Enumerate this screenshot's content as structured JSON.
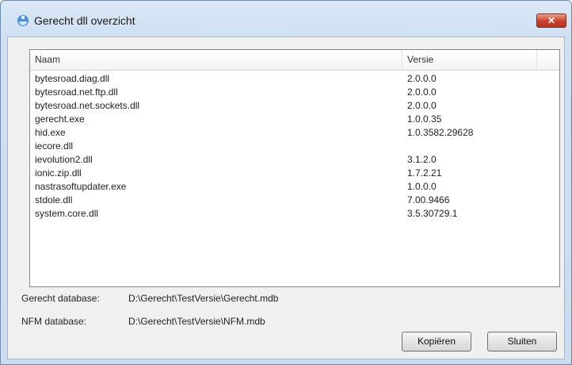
{
  "window": {
    "title": "Gerecht dll overzicht",
    "close_label": "✕"
  },
  "list": {
    "columns": {
      "naam": "Naam",
      "versie": "Versie"
    },
    "rows": [
      {
        "naam": "bytesroad.diag.dll",
        "versie": "2.0.0.0"
      },
      {
        "naam": "bytesroad.net.ftp.dll",
        "versie": "2.0.0.0"
      },
      {
        "naam": "bytesroad.net.sockets.dll",
        "versie": "2.0.0.0"
      },
      {
        "naam": "gerecht.exe",
        "versie": "1.0.0.35"
      },
      {
        "naam": "hid.exe",
        "versie": "1.0.3582.29628"
      },
      {
        "naam": "iecore.dll",
        "versie": ""
      },
      {
        "naam": "ievolution2.dll",
        "versie": "3.1.2.0"
      },
      {
        "naam": "ionic.zip.dll",
        "versie": "1.7.2.21"
      },
      {
        "naam": "nastrasoftupdater.exe",
        "versie": "1.0.0.0"
      },
      {
        "naam": "stdole.dll",
        "versie": "7.00.9466"
      },
      {
        "naam": "system.core.dll",
        "versie": "3.5.30729.1"
      }
    ]
  },
  "info": {
    "gerecht_label": "Gerecht database:",
    "gerecht_value": "D:\\Gerecht\\TestVersie\\Gerecht.mdb",
    "nfm_label": "NFM database:",
    "nfm_value": "D:\\Gerecht\\TestVersie\\NFM.mdb"
  },
  "buttons": {
    "copy": "Kopiëren",
    "close": "Sluiten"
  },
  "icons": {
    "app": "app-icon",
    "close": "close-icon"
  }
}
